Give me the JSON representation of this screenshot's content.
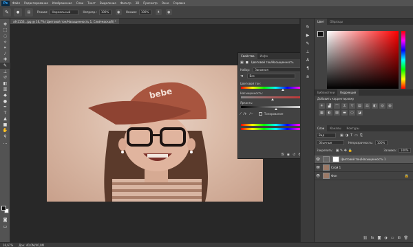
{
  "app": {
    "logo": "Ps"
  },
  "menu": [
    "Файл",
    "Редактирование",
    "Изображение",
    "Слои",
    "Текст",
    "Выделение",
    "Фильтр",
    "3D",
    "Просмотр",
    "Окно",
    "Справка"
  ],
  "options": {
    "mode_label": "Режим:",
    "mode_value": "Нормальный",
    "opacity_label": "Непрозр.:",
    "opacity_value": "100%",
    "flow_label": "Нажим:",
    "flow_value": "100%"
  },
  "document": {
    "tab_title": "x8-2153...jpg @ 16,7% (Цветовой тон/Насыщенность 1, Слой-маска/8) *",
    "zoom": "16,67%",
    "doc_info": "Док: 40,0М/40,0М"
  },
  "properties": {
    "tabs": [
      "Свойства",
      "Инфо"
    ],
    "header": "Цветовой тон/Насыщенность",
    "preset_label": "Набор:",
    "preset_value": "Заказная",
    "channel_value": "Все",
    "hue_label": "Цветовой тон:",
    "hue_value": "17",
    "sat_label": "Насыщенность:",
    "sat_value": "31",
    "light_label": "Яркость:",
    "light_value": "0",
    "hue_pos": 0.6,
    "sat_pos": 0.46,
    "light_pos": 0.5,
    "colorize_label": "Тонирование"
  },
  "right": {
    "color_tabs": [
      "Цвет",
      "Образцы"
    ],
    "adj_tabs": [
      "Библиотеки",
      "Коррекция"
    ],
    "adj_hint": "Добавить корректировку",
    "layers_tabs": [
      "Слои",
      "Каналы",
      "Контуры"
    ],
    "kind_label": "Вид",
    "blend_value": "Обычные",
    "opacity_label": "Непрозрачность:",
    "opacity_value": "100%",
    "lock_label": "Закрепить:",
    "fill_label": "Заливка:",
    "fill_value": "100%",
    "layers": [
      {
        "name": "Цветовой тон/Насыщенность 1",
        "selected": true
      },
      {
        "name": "Слой 1",
        "selected": false
      },
      {
        "name": "Фон",
        "selected": false
      }
    ]
  }
}
